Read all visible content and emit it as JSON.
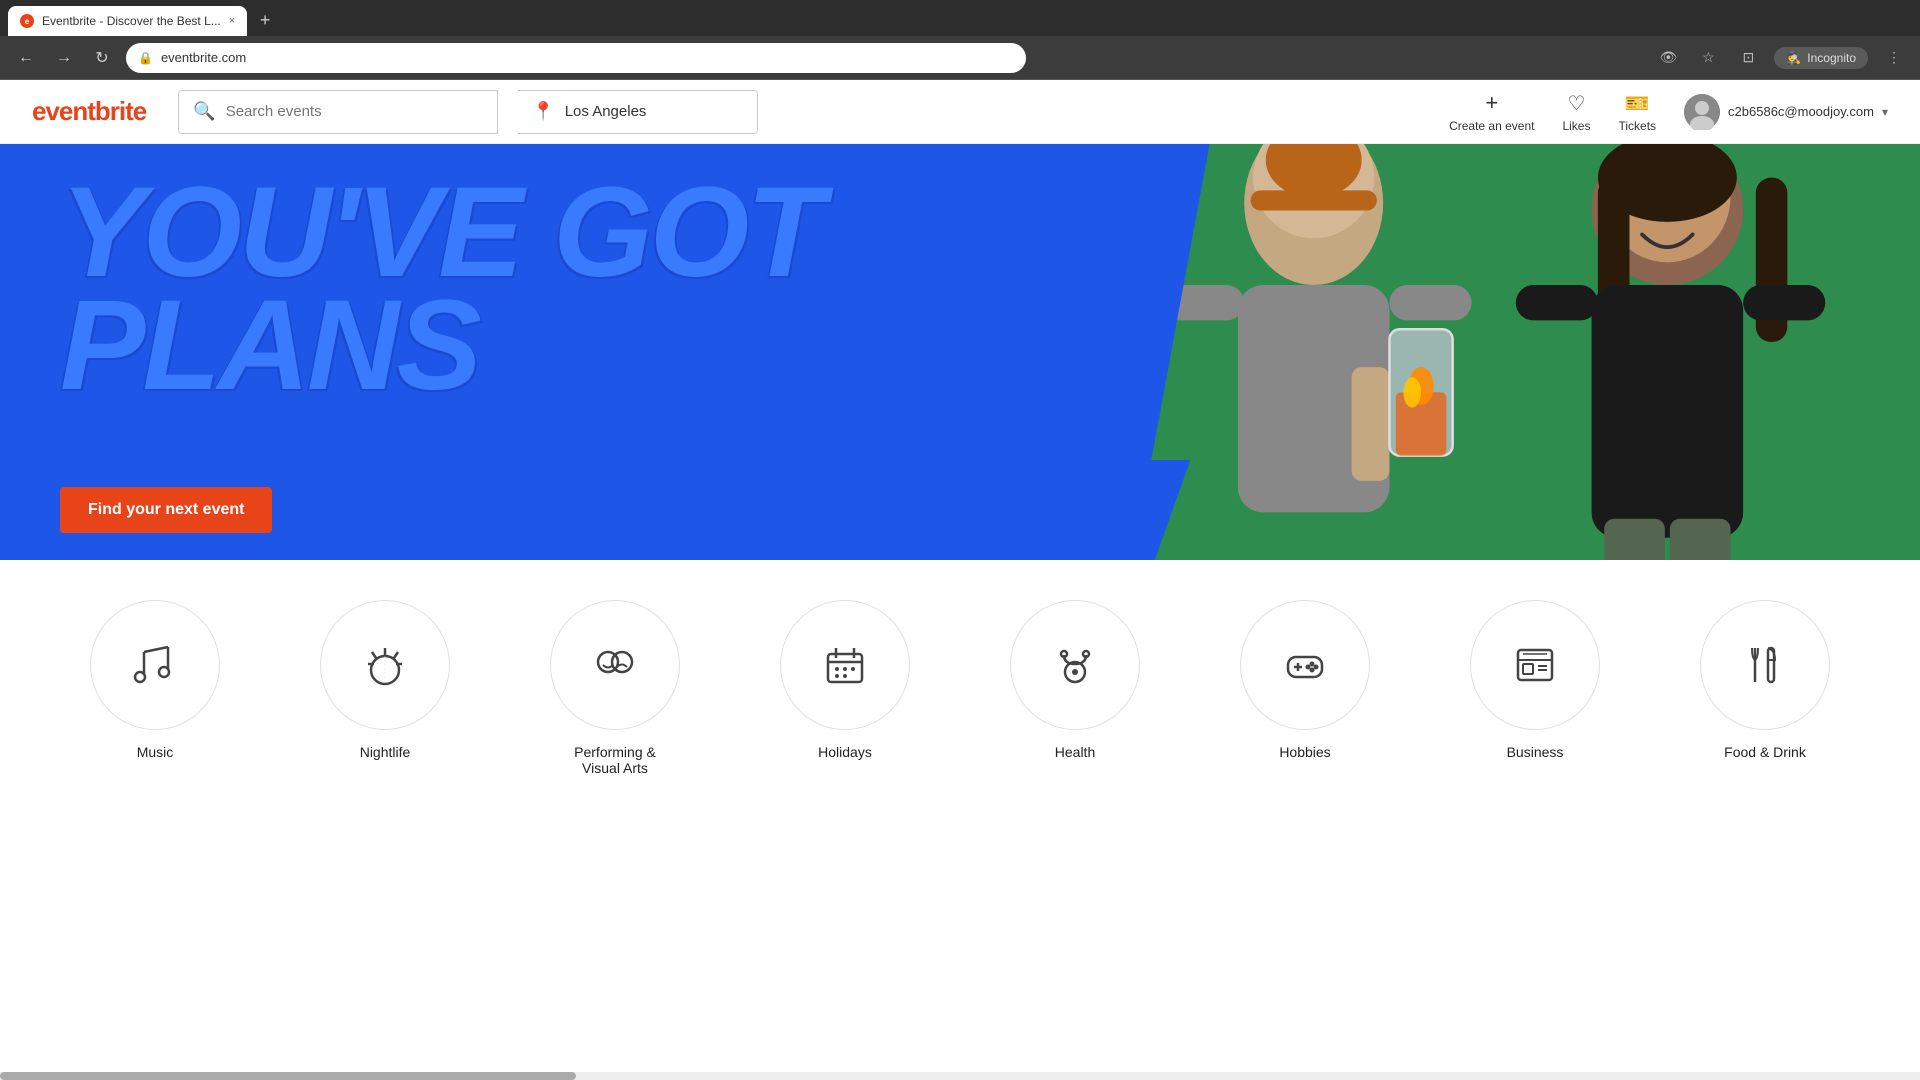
{
  "browser": {
    "tab_title": "Eventbrite - Discover the Best L...",
    "url": "eventbrite.com",
    "new_tab_label": "+",
    "close_label": "×",
    "incognito_label": "Incognito"
  },
  "nav": {
    "logo": "eventbrite",
    "search_placeholder": "Search events",
    "location_value": "Los Angeles",
    "create_event_label": "Create an event",
    "likes_label": "Likes",
    "tickets_label": "Tickets",
    "user_email": "c2b6586c@moodjoy.com"
  },
  "hero": {
    "headline_line1": "YOU'VE GOT",
    "headline_line2": "PLANS",
    "cta_label": "Find your next event"
  },
  "categories": [
    {
      "id": "music",
      "label": "Music",
      "icon": "music"
    },
    {
      "id": "nightlife",
      "label": "Nightlife",
      "icon": "nightlife"
    },
    {
      "id": "performing-visual-arts",
      "label": "Performing & Visual Arts",
      "icon": "arts"
    },
    {
      "id": "holidays",
      "label": "Holidays",
      "icon": "holidays"
    },
    {
      "id": "health",
      "label": "Health",
      "icon": "health"
    },
    {
      "id": "hobbies",
      "label": "Hobbies",
      "icon": "hobbies"
    },
    {
      "id": "business",
      "label": "Business",
      "icon": "business"
    },
    {
      "id": "food-drink",
      "label": "Food & Drink",
      "icon": "food"
    }
  ]
}
